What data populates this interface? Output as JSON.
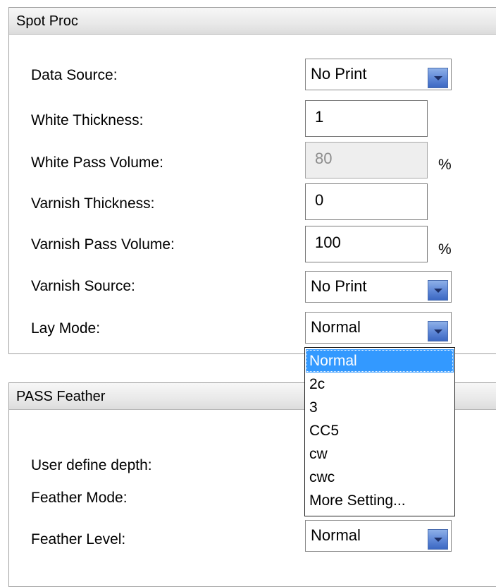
{
  "spot_proc": {
    "title": "Spot Proc",
    "data_source": {
      "label": "Data Source:",
      "value": "No Print"
    },
    "white_thickness": {
      "label": "White Thickness:",
      "value": "1"
    },
    "white_pass_volume": {
      "label": "White Pass Volume:",
      "value": "80",
      "unit": "%"
    },
    "varnish_thickness": {
      "label": "Varnish Thickness:",
      "value": "0"
    },
    "varnish_pass_volume": {
      "label": "Varnish Pass Volume:",
      "value": "100",
      "unit": "%"
    },
    "varnish_source": {
      "label": "Varnish Source:",
      "value": "No Print"
    },
    "lay_mode": {
      "label": "Lay Mode:",
      "value": "Normal",
      "options": [
        "Normal",
        "2c",
        "3",
        "CC5",
        "cw",
        "cwc",
        "More Setting..."
      ]
    }
  },
  "pass_feather": {
    "title": "PASS Feather",
    "user_define_depth": {
      "label": "User define depth:"
    },
    "feather_mode": {
      "label": "Feather Mode:"
    },
    "feather_level": {
      "label": "Feather Level:",
      "value": "Normal"
    }
  },
  "colors": {
    "selection": "#3399ff",
    "header_gradient_top": "#f7f7f7",
    "header_gradient_bottom": "#dcdcdc",
    "combo_arrow": "#5d86d6"
  }
}
